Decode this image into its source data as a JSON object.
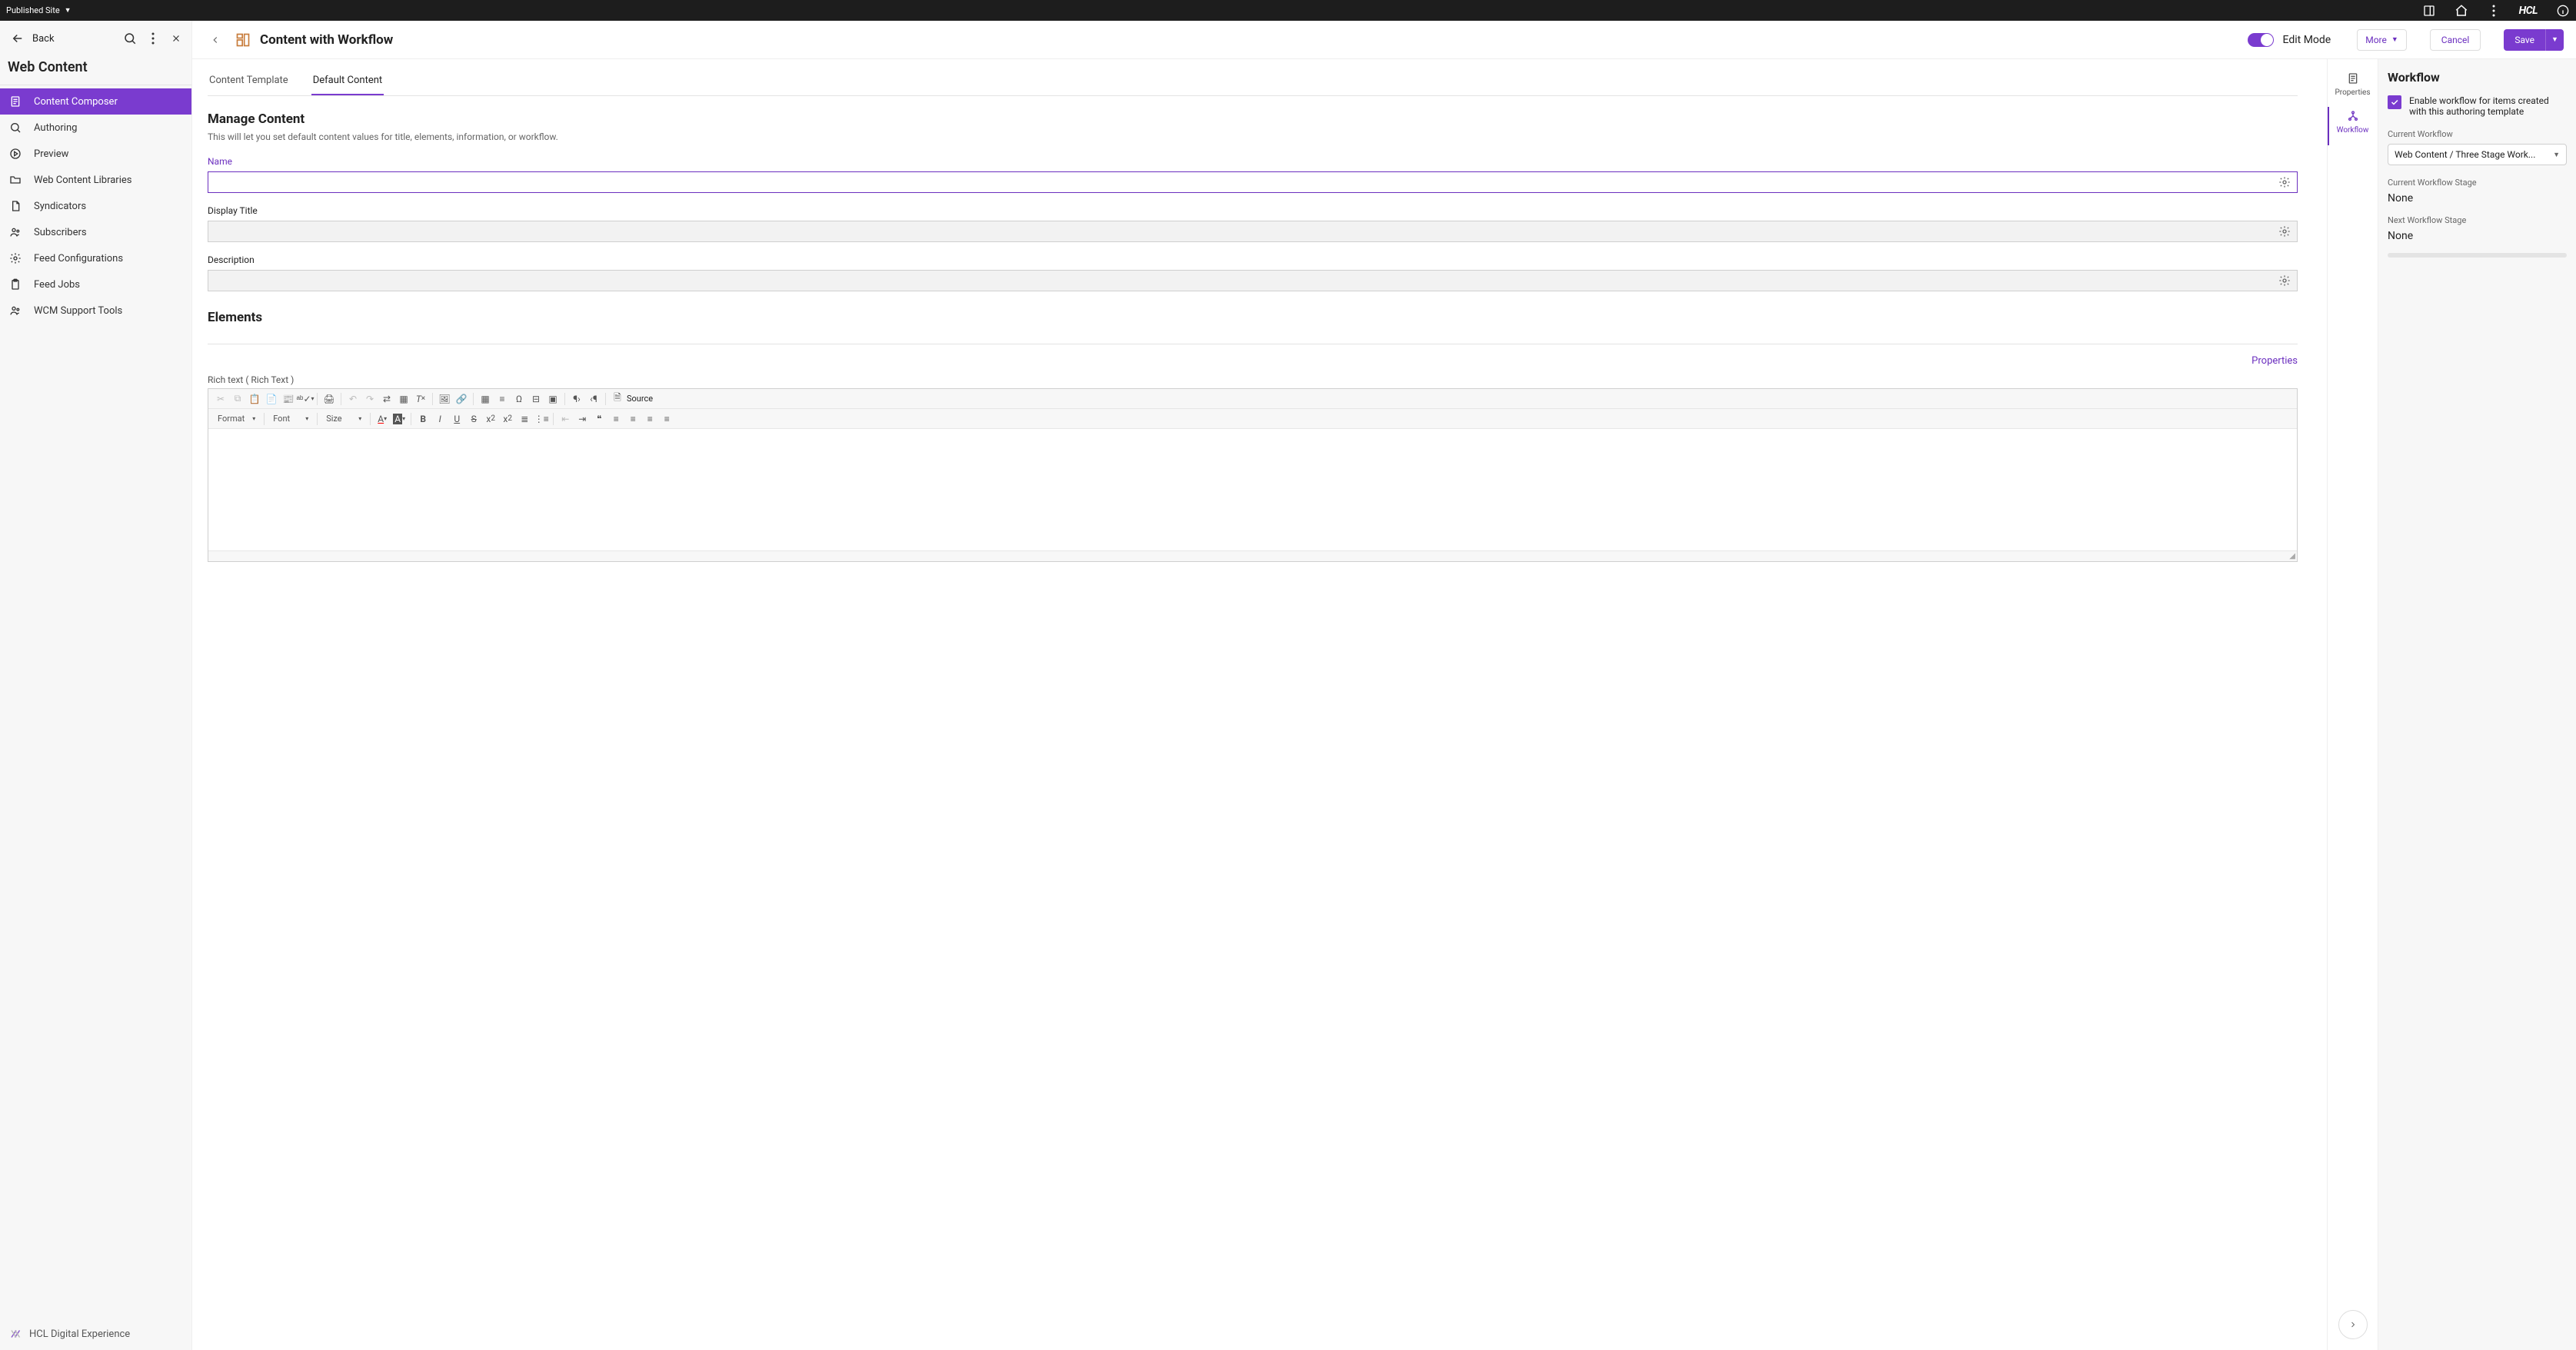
{
  "topbar": {
    "site_label": "Published Site",
    "brand": "HCL"
  },
  "sidebar": {
    "back_label": "Back",
    "title": "Web Content",
    "items": [
      {
        "label": "Content Composer",
        "active": true
      },
      {
        "label": "Authoring",
        "active": false
      },
      {
        "label": "Preview",
        "active": false
      },
      {
        "label": "Web Content Libraries",
        "active": false
      },
      {
        "label": "Syndicators",
        "active": false
      },
      {
        "label": "Subscribers",
        "active": false
      },
      {
        "label": "Feed Configurations",
        "active": false
      },
      {
        "label": "Feed Jobs",
        "active": false
      },
      {
        "label": "WCM Support Tools",
        "active": false
      }
    ],
    "footer": "HCL Digital Experience"
  },
  "page": {
    "title": "Content with Workflow",
    "edit_mode_label": "Edit Mode",
    "more_label": "More",
    "cancel_label": "Cancel",
    "save_label": "Save"
  },
  "tabs": [
    {
      "label": "Content Template",
      "active": false
    },
    {
      "label": "Default Content",
      "active": true
    }
  ],
  "manage": {
    "heading": "Manage Content",
    "subtitle": "This will let you set default content values for title, elements, information, or workflow.",
    "fields": {
      "name": {
        "label": "Name",
        "value": ""
      },
      "display_title": {
        "label": "Display Title",
        "value": ""
      },
      "description": {
        "label": "Description",
        "value": ""
      }
    }
  },
  "elements": {
    "heading": "Elements",
    "properties_link": "Properties",
    "richtext_label": "Rich text ( Rich Text )",
    "toolbar": {
      "format": "Format",
      "font": "Font",
      "size": "Size",
      "source": "Source"
    }
  },
  "midnav": [
    {
      "label": "Properties",
      "active": false
    },
    {
      "label": "Workflow",
      "active": true
    }
  ],
  "workflow": {
    "heading": "Workflow",
    "enable_label": "Enable workflow for items created with this authoring template",
    "enable_checked": true,
    "current_workflow_label": "Current Workflow",
    "current_workflow_value": "Web Content / Three Stage Work...",
    "current_stage_label": "Current Workflow Stage",
    "current_stage_value": "None",
    "next_stage_label": "Next Workflow Stage",
    "next_stage_value": "None"
  }
}
